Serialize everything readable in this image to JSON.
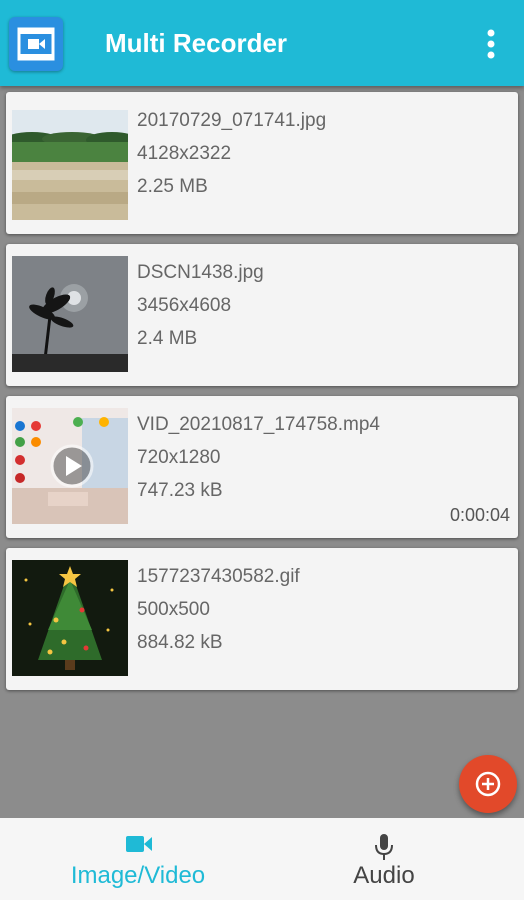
{
  "app": {
    "title": "Multi Recorder",
    "icons": {
      "logo": "video-camera-icon",
      "menu": "more-vert-icon"
    },
    "colors": {
      "primary": "#1fbad6",
      "fab": "#e2492a",
      "background": "#8c8c8c"
    }
  },
  "files": [
    {
      "name": "20170729_071741.jpg",
      "dimensions": "4128x2322",
      "size": "2.25 MB",
      "type": "image"
    },
    {
      "name": "DSCN1438.jpg",
      "dimensions": "3456x4608",
      "size": "2.4 MB",
      "type": "image"
    },
    {
      "name": "VID_20210817_174758.mp4",
      "dimensions": "720x1280",
      "size": "747.23 kB",
      "type": "video",
      "duration": "0:00:04"
    },
    {
      "name": "1577237430582.gif",
      "dimensions": "500x500",
      "size": "884.82 kB",
      "type": "gif"
    }
  ],
  "fab": {
    "icon": "add-circle-icon"
  },
  "tabs": [
    {
      "label": "Image/Video",
      "icon": "videocam-icon",
      "active": true
    },
    {
      "label": "Audio",
      "icon": "mic-icon",
      "active": false
    }
  ]
}
